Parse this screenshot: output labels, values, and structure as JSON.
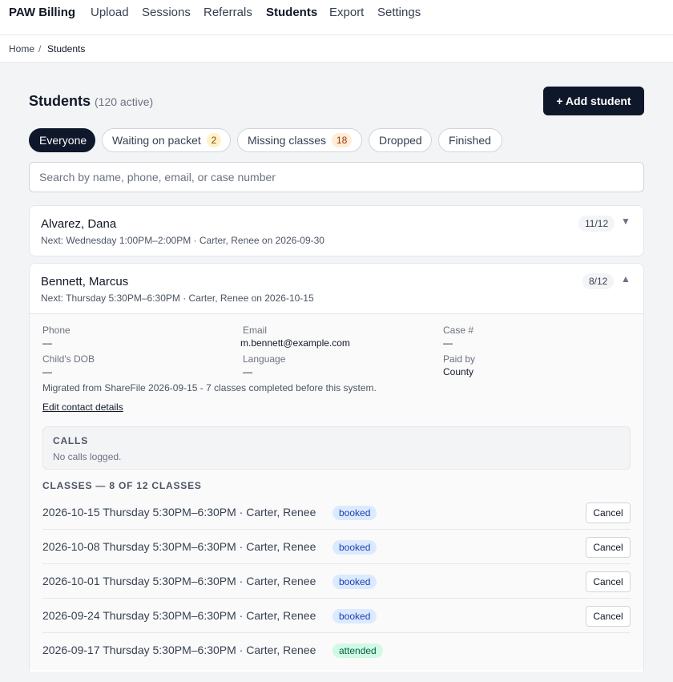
{
  "app": {
    "brand": "PAW Billing"
  },
  "nav": {
    "items": [
      "Upload",
      "Sessions",
      "Referrals",
      "Students",
      "Export",
      "Settings"
    ],
    "active": "Students"
  },
  "breadcrumb": {
    "home": "Home",
    "separator": "/",
    "current": "Students"
  },
  "header": {
    "title": "Students",
    "count": "(120 active)",
    "add_label": "+ Add student"
  },
  "filters": [
    {
      "label": "Everyone",
      "count": null,
      "active": true
    },
    {
      "label": "Waiting on packet",
      "count": "2"
    },
    {
      "label": "Missing classes",
      "count": "18"
    },
    {
      "label": "Dropped",
      "count": null
    },
    {
      "label": "Finished",
      "count": null
    }
  ],
  "search": {
    "placeholder": "Search by name, phone, email, or case number",
    "value": ""
  },
  "students": [
    {
      "name": "Alvarez, Dana",
      "next": "Next: Wednesday 1:00PM–2:00PM · Carter, Renee on 2026-09-30",
      "progress": "11/12",
      "expanded": false,
      "chevron": "▼"
    },
    {
      "name": "Bennett, Marcus",
      "next": "Next: Thursday 5:30PM–6:30PM · Carter, Renee on 2026-10-15",
      "progress": "8/12",
      "expanded": true,
      "chevron": "▲",
      "details": {
        "phone_label": "Phone",
        "phone": "—",
        "email_label": "Email",
        "email": "m.bennett@example.com",
        "case_label": "Case #",
        "case": "—",
        "dob_label": "Child's DOB",
        "dob": "—",
        "language_label": "Language",
        "language": "—",
        "paid_label": "Paid by",
        "paid": "County",
        "note": "Migrated from ShareFile 2026-09-15 - 7 classes completed before this system.",
        "edit_label": "Edit contact details",
        "calls_heading": "CALLS",
        "calls_empty": "No calls logged.",
        "classes_heading": "CLASSES — 8 OF 12 CLASSES",
        "cancel_label": "Cancel",
        "classes": [
          {
            "text": "2026-10-15 Thursday 5:30PM–6:30PM · Carter, Renee",
            "status": "booked"
          },
          {
            "text": "2026-10-08 Thursday 5:30PM–6:30PM · Carter, Renee",
            "status": "booked"
          },
          {
            "text": "2026-10-01 Thursday 5:30PM–6:30PM · Carter, Renee",
            "status": "booked"
          },
          {
            "text": "2026-09-24 Thursday 5:30PM–6:30PM · Carter, Renee",
            "status": "booked"
          },
          {
            "text": "2026-09-17 Thursday 5:30PM–6:30PM · Carter, Renee",
            "status": "attended"
          }
        ]
      }
    }
  ]
}
